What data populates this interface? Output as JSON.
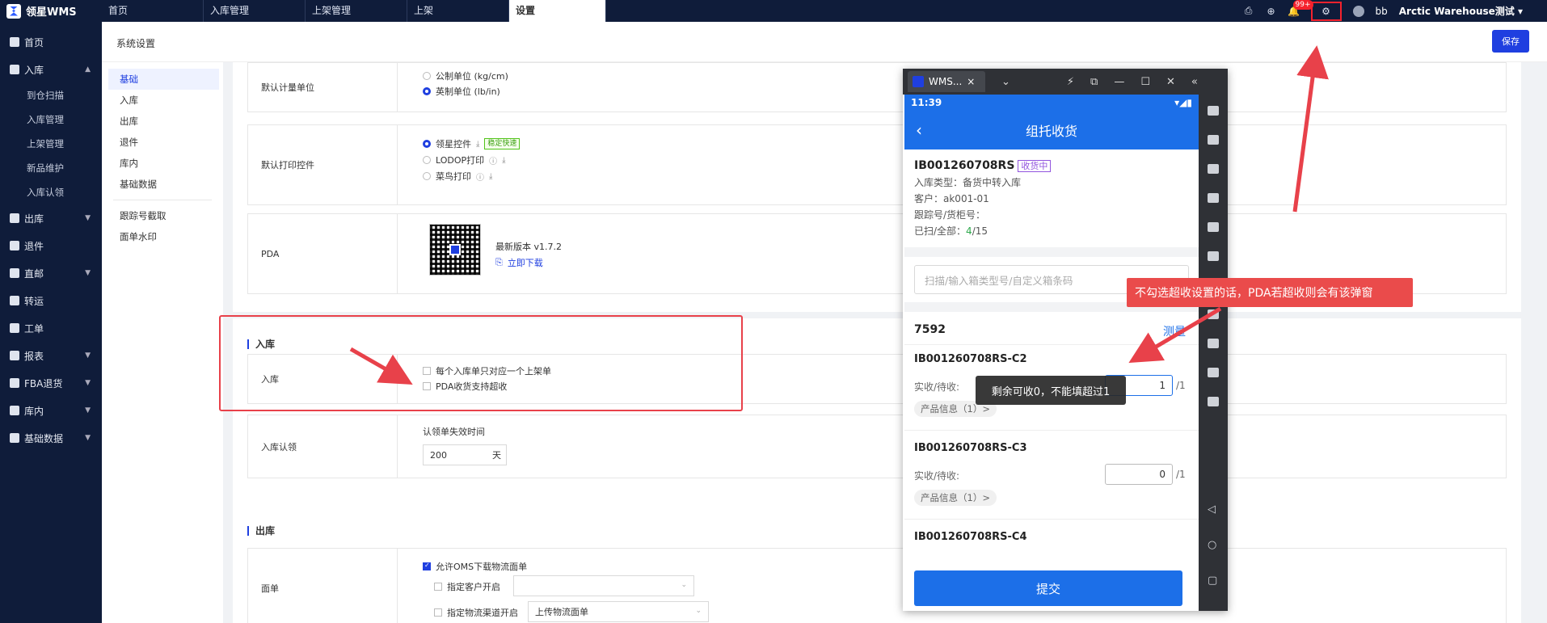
{
  "topbar": {
    "logo": "领星WMS",
    "tabs": [
      "首页",
      "入库管理",
      "上架管理",
      "上架",
      "设置"
    ],
    "active_tab": 4,
    "notif_badge": "99+",
    "user": "bb",
    "warehouse": "Arctic Warehouse测试"
  },
  "sidebar": {
    "items": [
      {
        "label": "首页"
      },
      {
        "label": "入库",
        "expanded": true,
        "children": [
          "到仓扫描",
          "入库管理",
          "上架管理",
          "新品维护",
          "入库认领"
        ]
      },
      {
        "label": "出库"
      },
      {
        "label": "退件"
      },
      {
        "label": "直邮"
      },
      {
        "label": "转运"
      },
      {
        "label": "工单"
      },
      {
        "label": "报表"
      },
      {
        "label": "FBA退货"
      },
      {
        "label": "库内"
      },
      {
        "label": "基础数据"
      }
    ]
  },
  "header": {
    "title": "系统设置",
    "save": "保存"
  },
  "subnav": {
    "items": [
      "基础",
      "入库",
      "出库",
      "退件",
      "库内",
      "基础数据"
    ],
    "items2": [
      "跟踪号截取",
      "面单水印"
    ]
  },
  "settings": {
    "unit": {
      "label": "默认计量单位",
      "opt1": "公制单位 (kg/cm)",
      "opt2": "英制单位 (lb/in)"
    },
    "print": {
      "label": "默认打印控件",
      "opt1": "领星控件",
      "badge": "稳定快速",
      "opt2": "LODOP打印",
      "opt3": "菜鸟打印"
    },
    "pda": {
      "label": "PDA",
      "version": "最新版本 v1.7.2",
      "download": "立即下载"
    },
    "inbound_section": "入库",
    "inbound": {
      "label": "入库",
      "chk1": "每个入库单只对应一个上架单",
      "chk2": "PDA收货支持超收"
    },
    "claim": {
      "label": "入库认领",
      "caption": "认领单失效时间",
      "value": "200",
      "unit": "天"
    },
    "outbound_section": "出库",
    "waybill": {
      "label": "面单",
      "chk1": "允许OMS下载物流面单",
      "chk2": "指定客户开启",
      "chk3": "指定物流渠道开启",
      "select3": "上传物流面单"
    }
  },
  "callout": "不勾选超收设置的话，PDA若超收则会有该弹窗",
  "phone": {
    "tab_title": "WMS...",
    "time": "11:39",
    "nav_title": "组托收货",
    "order_no": "IB001260708RS",
    "status_tag": "收货中",
    "type": "入库类型：备货中转入库",
    "customer": "客户：ak001-01",
    "tracking": "跟踪号/货柜号：",
    "scanned_label": "已扫/全部：",
    "scanned": "4",
    "total": "/15",
    "search_placeholder": "扫描/输入箱类型号/自定义箱条码",
    "box_no": "7592",
    "measure": "测量",
    "toast": "剩余可收0，不能填超过1",
    "items": [
      {
        "sku": "IB001260708RS-C2",
        "label": "实收/待收:",
        "value": "1",
        "total": "/1",
        "prod": "产品信息（1）>"
      },
      {
        "sku": "IB001260708RS-C3",
        "label": "实收/待收:",
        "value": "0",
        "total": "/1",
        "prod": "产品信息（1）>"
      }
    ],
    "partial_sku": "IB001260708RS-C4",
    "submit": "提交"
  },
  "colors": {
    "primary": "#1f3fe0",
    "annotation_red": "#e8414a",
    "nav_bg": "#0f1c3a",
    "pda_blue": "#1c6fe8"
  }
}
